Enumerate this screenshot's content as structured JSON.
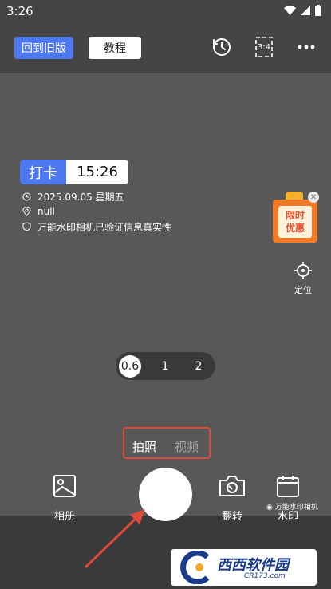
{
  "status_bar": {
    "time": "3:26"
  },
  "top_bar": {
    "old_version_label": "回到旧版",
    "tutorial_label": "教程",
    "ratio_label": "3:4"
  },
  "watermark": {
    "label": "打卡",
    "time": "15:26",
    "date_line": "2025.09.05 星期五",
    "location_line": "null",
    "verify_line": "万能水印相机已验证信息真实性"
  },
  "promo": {
    "line1": "限时",
    "line2": "优惠"
  },
  "locate_label": "定位",
  "zoom": {
    "options": [
      "0.6",
      "1",
      "2"
    ],
    "selected": "0.6"
  },
  "modes": {
    "photo": "拍照",
    "video": "视频",
    "selected": "拍照"
  },
  "tools": {
    "album": "相册",
    "flip": "翻转",
    "watermark": "水印"
  },
  "brand": "万能水印相机",
  "overlay_logo": {
    "name": "西西软件园",
    "domain": "CR173.com"
  }
}
